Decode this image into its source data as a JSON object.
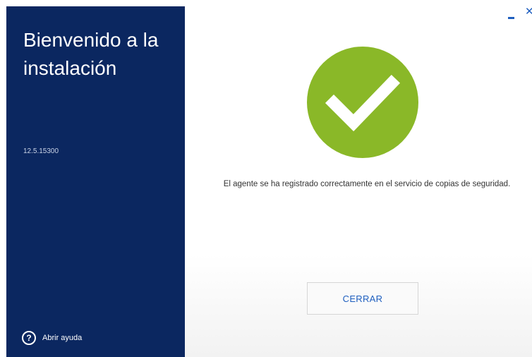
{
  "sidebar": {
    "title": "Bienvenido a la instalación",
    "version": "12.5.15300",
    "help_icon": "question-circle-icon",
    "help_label": "Abrir ayuda"
  },
  "window_controls": {
    "minimize_icon": "minimize-icon",
    "close_icon": "close-icon"
  },
  "main": {
    "status_icon": "check-circle-icon",
    "message": "El agente se ha registrado correctamente en el servicio de copias de seguridad.",
    "close_button_label": "CERRAR"
  },
  "colors": {
    "sidebar_bg": "#0b2760",
    "success_green": "#8ab828",
    "accent_blue": "#1f5fbf"
  }
}
